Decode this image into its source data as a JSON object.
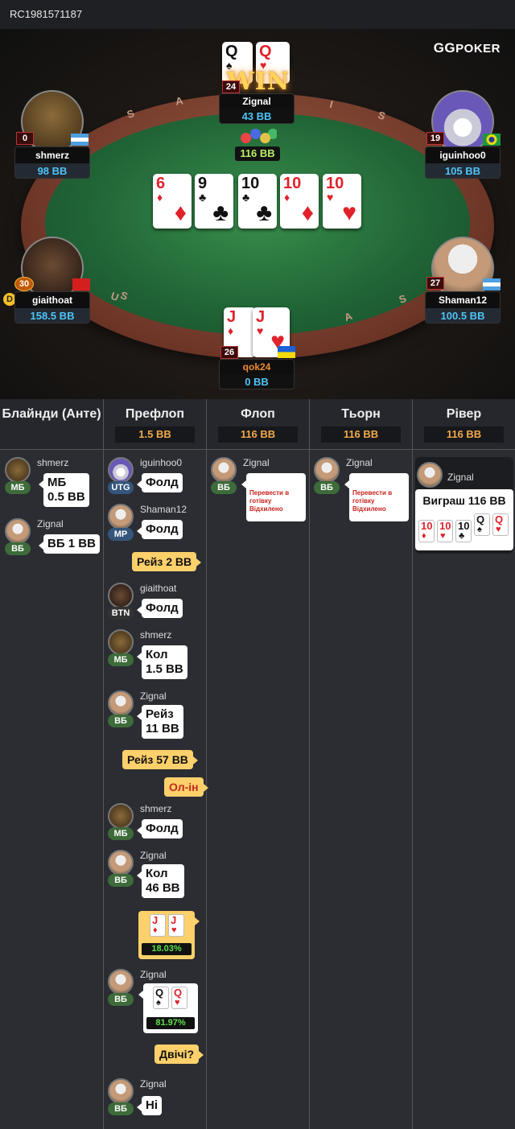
{
  "hand_id": "RC1981571187",
  "logo": {
    "gg": "GG",
    "poker": "POKER"
  },
  "rail_letters": [
    "S",
    "A",
    "I",
    "S",
    "U",
    "S",
    "A",
    "S"
  ],
  "win_text": "WIN",
  "pot": "116 BB",
  "board": [
    {
      "rank": "6",
      "suit": "♦",
      "color": "red"
    },
    {
      "rank": "9",
      "suit": "♣",
      "color": "black"
    },
    {
      "rank": "10",
      "suit": "♣",
      "color": "black"
    },
    {
      "rank": "10",
      "suit": "♦",
      "color": "red"
    },
    {
      "rank": "10",
      "suit": "♥",
      "color": "red"
    }
  ],
  "seats": {
    "zignal": {
      "name": "Zignal",
      "stack": "43 BB",
      "level": "24",
      "cards": [
        {
          "rank": "Q",
          "suit": "♠",
          "color": "black"
        },
        {
          "rank": "Q",
          "suit": "♥",
          "color": "red"
        }
      ]
    },
    "shmerz": {
      "name": "shmerz",
      "stack": "98 BB",
      "level": "0"
    },
    "iguinhoo": {
      "name": "iguinhoo0",
      "stack": "105 BB",
      "level": "19"
    },
    "giaithoat": {
      "name": "giaithoat",
      "stack": "158.5 BB",
      "level": "30",
      "dealer": "D"
    },
    "shaman": {
      "name": "Shaman12",
      "stack": "100.5 BB",
      "level": "27"
    },
    "qok": {
      "name": "qok24",
      "stack": "0 BB",
      "level": "26",
      "cards": [
        {
          "rank": "J",
          "suit": "♦",
          "color": "red"
        },
        {
          "rank": "J",
          "suit": "♥",
          "color": "red"
        }
      ]
    }
  },
  "columns": [
    {
      "title": "Блайнди (Анте)",
      "pot": ""
    },
    {
      "title": "Префлоп",
      "pot": "1.5 BB"
    },
    {
      "title": "Флоп",
      "pot": "116 BB"
    },
    {
      "title": "Тьорн",
      "pot": "116 BB"
    },
    {
      "title": "Рівер",
      "pot": "116 BB"
    }
  ],
  "blinds": [
    {
      "name": "shmerz",
      "pos": "МБ",
      "action_1": "МБ",
      "action_2": "0.5 BB"
    },
    {
      "name": "Zignal",
      "pos": "ВБ",
      "action_1": "ВБ 1 BB"
    }
  ],
  "preflop": {
    "a1": {
      "name": "iguinhoo0",
      "pos": "UTG",
      "action": "Фолд"
    },
    "a2": {
      "name": "Shaman12",
      "pos": "MP",
      "action": "Фолд"
    },
    "y1": "Рейз 2 BB",
    "a3": {
      "name": "giaithoat",
      "pos": "BTN",
      "action": "Фолд"
    },
    "a4": {
      "name": "shmerz",
      "pos": "МБ",
      "action_1": "Кол",
      "action_2": "1.5 BB"
    },
    "a5": {
      "name": "Zignal",
      "pos": "ВБ",
      "action_1": "Рейз",
      "action_2": "11 BB"
    },
    "y2": "Рейз 57 BB",
    "y3": "Ол-ін",
    "a6": {
      "name": "shmerz",
      "pos": "МБ",
      "action": "Фолд"
    },
    "a7": {
      "name": "Zignal",
      "pos": "ВБ",
      "action_1": "Кол",
      "action_2": "46 BB"
    },
    "hero_cards": [
      {
        "rank": "J",
        "suit": "♦",
        "color": "red"
      },
      {
        "rank": "J",
        "suit": "♥",
        "color": "red"
      }
    ],
    "hero_equity": "18.03%",
    "a8": {
      "name": "Zignal",
      "pos": "ВБ"
    },
    "villain_cards": [
      {
        "rank": "Q",
        "suit": "♠",
        "color": "black"
      },
      {
        "rank": "Q",
        "suit": "♥",
        "color": "red"
      }
    ],
    "villain_equity": "81.97%",
    "y4": "Двічі?",
    "a9": {
      "name": "Zignal",
      "pos": "ВБ",
      "action": "Ні"
    }
  },
  "flop": {
    "name": "Zignal",
    "pos": "ВБ",
    "line_1": "Перевести в готівку",
    "line_2": "Відхилено"
  },
  "turn": {
    "name": "Zignal",
    "pos": "ВБ",
    "line_1": "Перевести в готівку",
    "line_2": "Відхилено"
  },
  "river": {
    "name": "Zignal",
    "result": "Виграш 116 BB",
    "cards": [
      {
        "rank": "10",
        "suit": "♦",
        "color": "red"
      },
      {
        "rank": "10",
        "suit": "♥",
        "color": "red"
      },
      {
        "rank": "10",
        "suit": "♣",
        "color": "black"
      },
      {
        "rank": "Q",
        "suit": "♠",
        "color": "black"
      },
      {
        "rank": "Q",
        "suit": "♥",
        "color": "red"
      }
    ]
  }
}
